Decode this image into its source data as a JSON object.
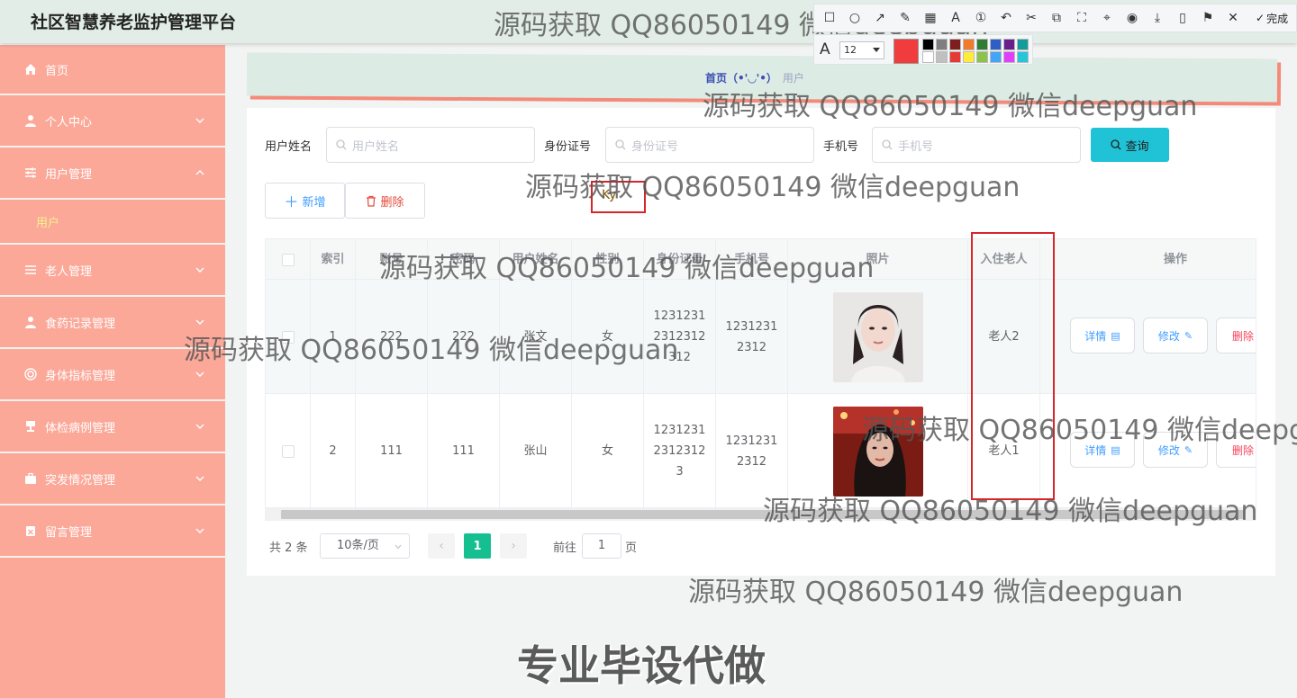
{
  "app": {
    "title": "社区智慧养老监护管理平台"
  },
  "sidebar": {
    "items": [
      {
        "label": "首页",
        "icon": "home-icon"
      },
      {
        "label": "个人中心",
        "icon": "user-icon"
      },
      {
        "label": "用户管理",
        "icon": "sliders-icon",
        "expanded": true,
        "children": [
          "用户"
        ]
      },
      {
        "label": "老人管理",
        "icon": "list-icon"
      },
      {
        "label": "食药记录管理",
        "icon": "user-icon"
      },
      {
        "label": "身体指标管理",
        "icon": "target-icon"
      },
      {
        "label": "体检病例管理",
        "icon": "stamp-icon"
      },
      {
        "label": "突发情况管理",
        "icon": "briefcase-icon"
      },
      {
        "label": "留言管理",
        "icon": "clipboard-icon"
      }
    ]
  },
  "breadcrumb": {
    "home": "首页（•'◡'•）",
    "current": "用户"
  },
  "search": {
    "name_label": "用户姓名",
    "name_placeholder": "用户姓名",
    "id_label": "身份证号",
    "id_placeholder": "身份证号",
    "phone_label": "手机号",
    "phone_placeholder": "手机号",
    "query_label": "查询"
  },
  "actions": {
    "add_label": "新增",
    "delete_label": "删除"
  },
  "cursor_text": "Ky",
  "table": {
    "columns": [
      "索引",
      "账号",
      "密码",
      "用户姓名",
      "性别",
      "身份证号",
      "手机号",
      "照片",
      "入住老人",
      "操作"
    ],
    "rows": [
      {
        "index": "1",
        "account": "222",
        "password": "222",
        "name": "张文",
        "gender": "女",
        "id_number": "1231231\n2312312\n312",
        "phone": "1231231\n2312",
        "elder": "老人2"
      },
      {
        "index": "2",
        "account": "111",
        "password": "111",
        "name": "张山",
        "gender": "女",
        "id_number": "1231231\n2312312\n3",
        "phone": "1231231\n2312",
        "elder": "老人1"
      }
    ],
    "row_actions": {
      "detail": "详情",
      "edit": "修改",
      "delete": "删除"
    }
  },
  "pagination": {
    "total": "共 2 条",
    "page_size": "10条/页",
    "current_page": "1",
    "goto_label": "前往",
    "goto_value": "1",
    "page_suffix": "页"
  },
  "watermarks": {
    "repeat": "源码获取 QQ86050149 微信deepguan",
    "cut1": "源码获取 QQ86050149 微信deepguan",
    "cut2": "源码获取 QQ86050149 微信deepg",
    "big": "专业毕设代做"
  },
  "annotation_toolbar": {
    "done_label": "完成",
    "font_size": "12",
    "current_color": "#f03c3c",
    "swatches": [
      "#000000",
      "#7f7f7f",
      "#7f1e1e",
      "#f07b2b",
      "#2e7d32",
      "#2f5fc4",
      "#6a1e8c",
      "#139c9c",
      "#ffffff",
      "#c0c0c0",
      "#e53935",
      "#ffeb3b",
      "#8bc34a",
      "#42a5f5",
      "#e040fb",
      "#26c6da"
    ]
  },
  "colors": {
    "sidebar_bg": "#fba899",
    "topbar_bg": "#e1ede6",
    "query_btn": "#20c2d6",
    "page_active": "#16bf8f",
    "annotation_red": "#d7262a"
  }
}
